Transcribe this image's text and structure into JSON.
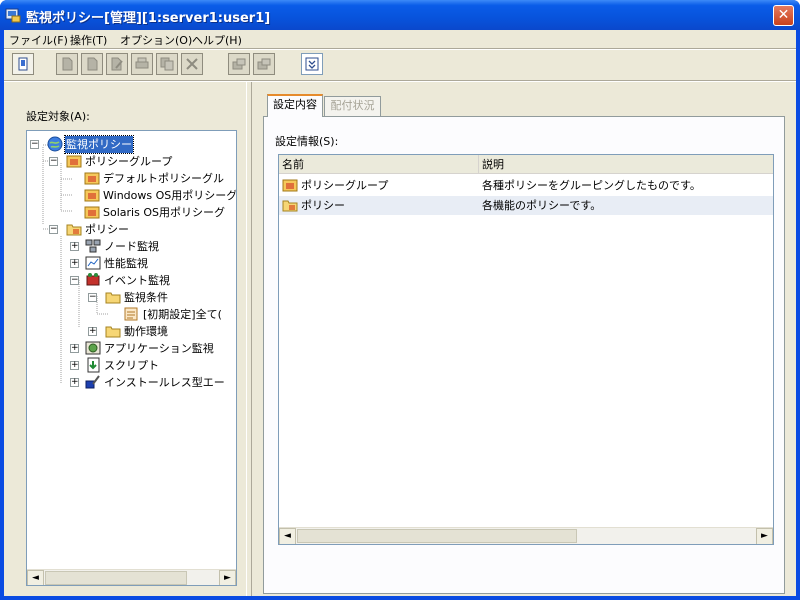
{
  "window": {
    "title": "監視ポリシー[管理][1:server1:user1]",
    "close_glyph": "✕"
  },
  "menu": [
    {
      "label": "ファイル(F)"
    },
    {
      "label": "操作(T)"
    },
    {
      "label": "オプション(O)"
    },
    {
      "label": "ヘルプ(H)"
    }
  ],
  "toolbar": {
    "buttons": [
      "open-icon",
      "new-icon",
      "copy-icon",
      "edit-icon",
      "print-icon",
      "duplicate-icon",
      "delete-icon",
      "distribute-icon",
      "distribute-all-icon",
      "expand-icon"
    ]
  },
  "left_pane": {
    "label": "設定対象(A):",
    "tree": [
      {
        "label": "監視ポリシー",
        "icon": "globe-icon",
        "expander": "−",
        "selected": true
      },
      {
        "label": "ポリシーグループ",
        "icon": "policy-group-icon",
        "expander": "−"
      },
      {
        "label": "デフォルトポリシーグル",
        "icon": "policy-group-icon",
        "expander": ""
      },
      {
        "label": "Windows OS用ポリシーグ",
        "icon": "policy-group-icon",
        "expander": ""
      },
      {
        "label": "Solaris OS用ポリシーグ",
        "icon": "policy-group-icon",
        "expander": ""
      },
      {
        "label": "ポリシー",
        "icon": "policy-folder-icon",
        "expander": "−"
      },
      {
        "label": "ノード監視",
        "icon": "node-monitor-icon",
        "expander": "+"
      },
      {
        "label": "性能監視",
        "icon": "performance-monitor-icon",
        "expander": "+"
      },
      {
        "label": "イベント監視",
        "icon": "event-monitor-icon",
        "expander": "−"
      },
      {
        "label": "監視条件",
        "icon": "folder-icon",
        "expander": "−"
      },
      {
        "label": "[初期設定]全て(",
        "icon": "condition-icon",
        "expander": ""
      },
      {
        "label": "動作環境",
        "icon": "folder-icon",
        "expander": "+"
      },
      {
        "label": "アプリケーション監視",
        "icon": "application-monitor-icon",
        "expander": "+"
      },
      {
        "label": "スクリプト",
        "icon": "script-icon",
        "expander": "+"
      },
      {
        "label": "インストールレス型エー",
        "icon": "agentless-icon",
        "expander": "+"
      }
    ]
  },
  "right_pane": {
    "tabs": [
      {
        "label": "設定内容",
        "active": true
      },
      {
        "label": "配付状況",
        "active": false
      }
    ],
    "info_label": "設定情報(S):",
    "columns": [
      "名前",
      "説明"
    ],
    "rows": [
      {
        "name": "ポリシーグループ",
        "description": "各種ポリシーをグルーピングしたものです。",
        "icon": "policy-group-icon"
      },
      {
        "name": "ポリシー",
        "description": "各機能のポリシーです。",
        "icon": "policy-folder-icon"
      }
    ]
  },
  "scroll": {
    "left_arrow": "◄",
    "right_arrow": "►"
  },
  "colors": {
    "title_bar": "#0a5ce8",
    "selection": "#316ac5",
    "face": "#ece9d8"
  }
}
